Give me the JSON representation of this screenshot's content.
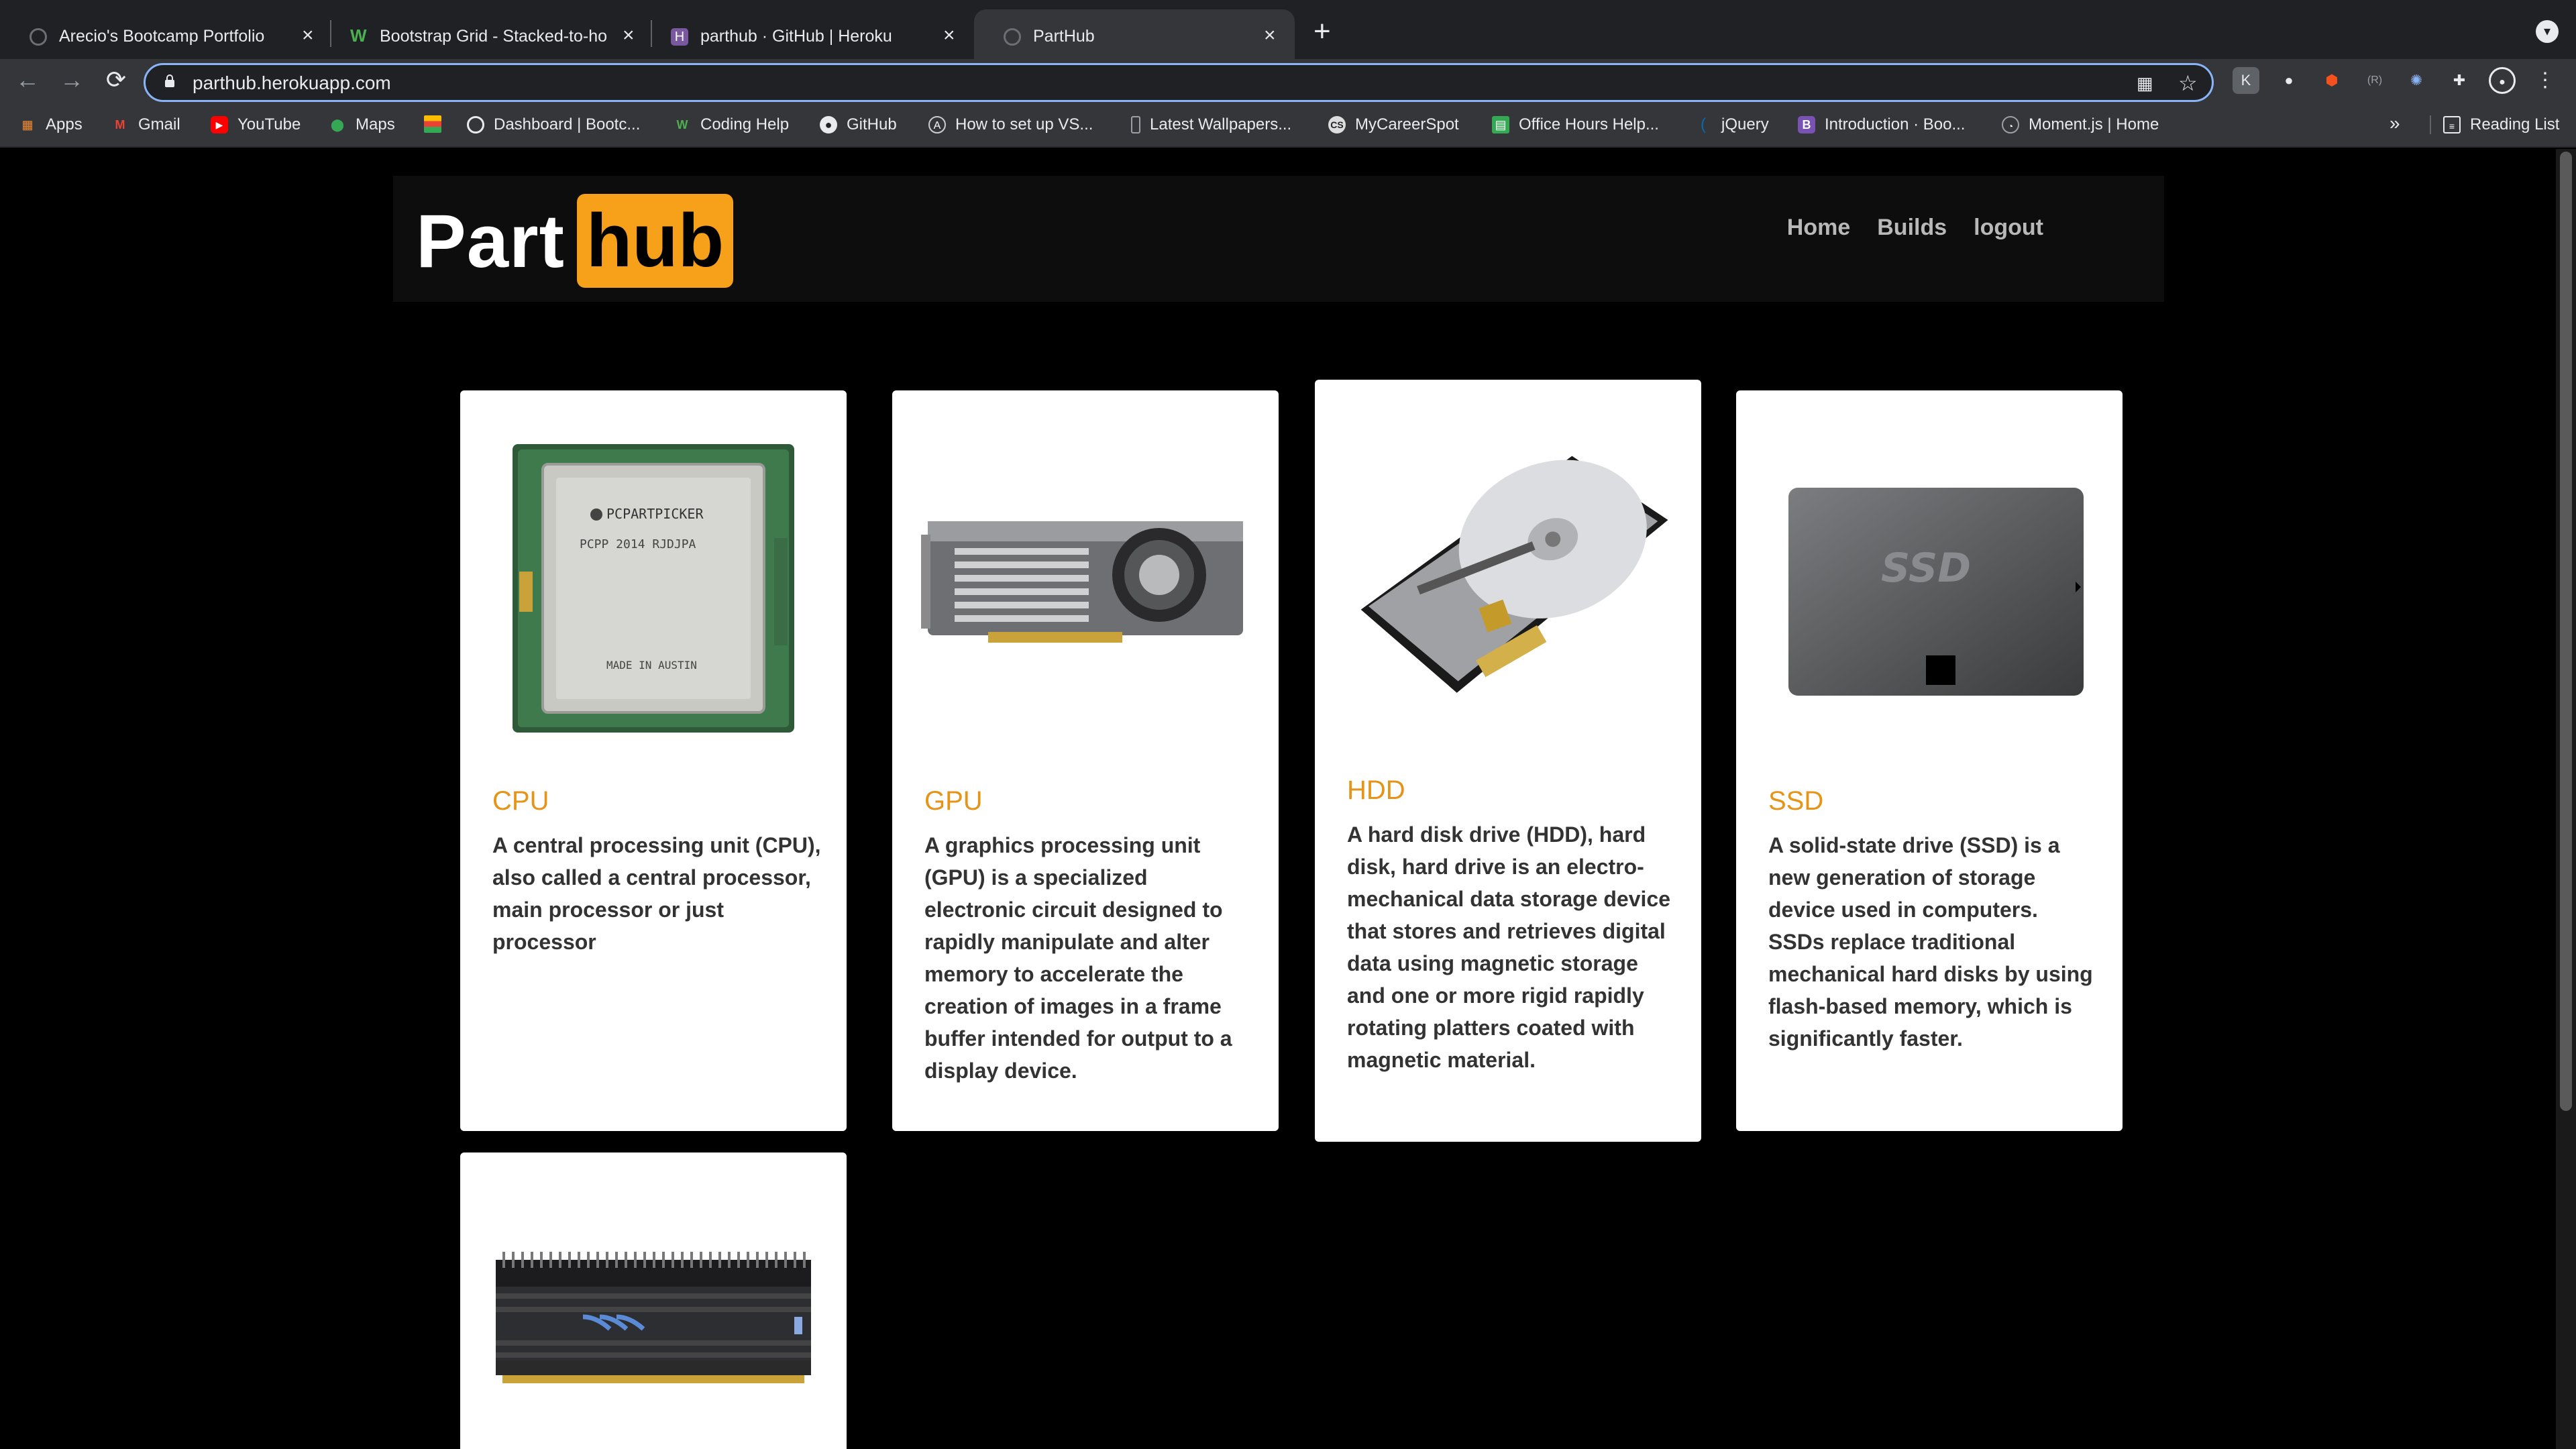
{
  "browser": {
    "tabs": [
      {
        "label": "Arecio's Bootcamp Portfolio",
        "active": false
      },
      {
        "label": "Bootstrap Grid - Stacked-to-ho",
        "active": false
      },
      {
        "label": "parthub · GitHub | Heroku",
        "active": false
      },
      {
        "label": "PartHub",
        "active": true
      }
    ],
    "url": "parthub.herokuapp.com",
    "bookmarks": [
      {
        "label": "Apps",
        "icon": "apps-grid-icon",
        "color": "#f28b30"
      },
      {
        "label": "Gmail",
        "icon": "gmail-icon",
        "color": "#ea4335"
      },
      {
        "label": "YouTube",
        "icon": "youtube-icon",
        "color": "#ff0000"
      },
      {
        "label": "Maps",
        "icon": "maps-pin-icon",
        "color": "#34a853"
      },
      {
        "label": "",
        "icon": "flag-icon",
        "color": "#fbbc04"
      },
      {
        "label": "Dashboard | Bootc...",
        "icon": "globe-icon",
        "color": "#9aa0a6"
      },
      {
        "label": "Coding Help",
        "icon": "w-icon",
        "color": "#4caf50"
      },
      {
        "label": "GitHub",
        "icon": "github-icon",
        "color": "#ffffff"
      },
      {
        "label": "How to set up VS...",
        "icon": "a-icon",
        "color": "#cccccc"
      },
      {
        "label": "Latest Wallpapers...",
        "icon": "phone-icon",
        "color": "#9aa0a6"
      },
      {
        "label": "MyCareerSpot",
        "icon": "cs-icon",
        "color": "#cccccc"
      },
      {
        "label": "Office Hours Help...",
        "icon": "sheets-icon",
        "color": "#34a853"
      },
      {
        "label": "jQuery",
        "icon": "jquery-icon",
        "color": "#0769ad"
      },
      {
        "label": "Introduction · Boo...",
        "icon": "bootstrap-icon",
        "color": "#7952b3"
      },
      {
        "label": "Moment.js | Home",
        "icon": "clock-icon",
        "color": "#9aa0a6"
      }
    ],
    "more_bookmarks": "»",
    "reading_list": "Reading List"
  },
  "site": {
    "logo_part": "Part",
    "logo_hub": "hub",
    "nav": [
      "Home",
      "Builds",
      "logout"
    ]
  },
  "cards": [
    {
      "title": "CPU",
      "description": "A central processing unit (CPU), also called a central processor, main processor or just processor",
      "image": "cpu-chip-image",
      "chip_text1": "PCPARTPICKER",
      "chip_text2": "PCPP 2014 RJDJPA",
      "chip_text3": "MADE IN AUSTIN"
    },
    {
      "title": "GPU",
      "description": "A graphics processing unit (GPU) is a specialized electronic circuit designed to rapidly manipulate and alter memory to accelerate the creation of images in a frame buffer intended for output to a display device.",
      "image": "gpu-card-image"
    },
    {
      "title": "HDD",
      "description": "A hard disk drive (HDD), hard disk, hard drive is an electro-mechanical data storage device that stores and retrieves digital data using magnetic storage and one or more rigid rapidly rotating platters coated with magnetic material.",
      "image": "hdd-image"
    },
    {
      "title": "SSD",
      "description": "A solid-state drive (SSD) is a new generation of storage device used in computers. SSDs replace traditional mechanical hard disks by using flash-based memory, which is significantly faster.",
      "image": "ssd-image",
      "ssd_label": "SSD"
    },
    {
      "title": "",
      "description": "",
      "image": "ram-stick-image"
    }
  ]
}
